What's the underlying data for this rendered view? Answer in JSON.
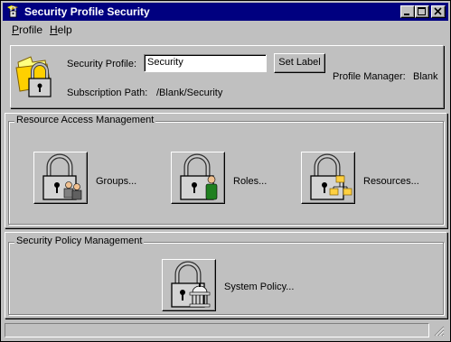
{
  "window": {
    "title": "Security Profile Security"
  },
  "menu": {
    "items": [
      {
        "label": "Profile"
      },
      {
        "label": "Help"
      }
    ]
  },
  "profile": {
    "security_profile_label": "Security Profile:",
    "security_profile_value": "Security",
    "set_label_button": "Set Label",
    "profile_manager_label": "Profile Manager:",
    "profile_manager_value": "Blank",
    "subscription_path_label": "Subscription Path:",
    "subscription_path_value": "/Blank/Security"
  },
  "resource_access": {
    "title": "Resource Access Management",
    "groups_label": "Groups...",
    "roles_label": "Roles...",
    "resources_label": "Resources..."
  },
  "policy": {
    "title": "Security Policy Management",
    "system_policy_label": "System Policy..."
  },
  "colors": {
    "titlebar": "#000080",
    "face": "#c0c0c0"
  }
}
